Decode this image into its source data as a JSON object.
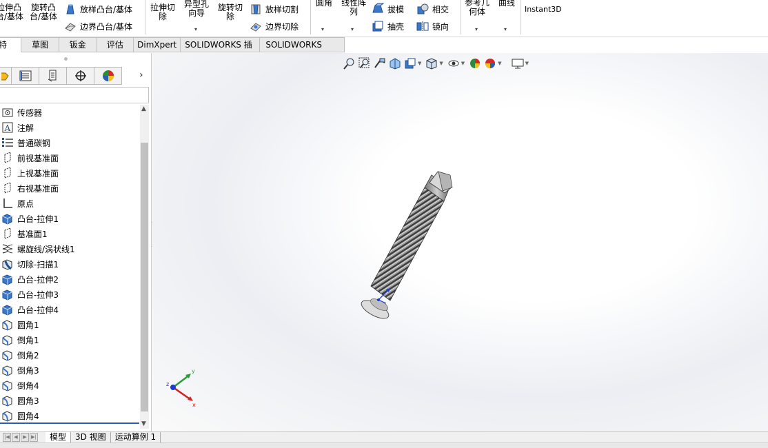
{
  "ribbon": {
    "extrude_boss_label": "拉伸凸\n台/基体",
    "revolve_boss_label": "旋转凸\n台/基体",
    "loft_boss_label": "放样凸台/基体",
    "boundary_boss_label": "边界凸台/基体",
    "extrude_cut_label": "拉伸切\n除",
    "hole_wizard_label": "异型孔\n向导",
    "revolve_cut_label": "旋转切\n除",
    "loft_cut_label": "放样切割",
    "boundary_cut_label": "边界切除",
    "fillet_label": "圆角",
    "linear_pattern_label": "线性阵\n列",
    "draft_label": "拔模",
    "intersect_label": "相交",
    "shell_label": "抽壳",
    "mirror_label": "镜向",
    "ref_geometry_label": "参考几\n何体",
    "curves_label": "曲线",
    "instant3d_label": "Instant3D"
  },
  "tabs": [
    "特征",
    "草图",
    "钣金",
    "评估",
    "DimXpert",
    "SOLIDWORKS 插件",
    "SOLIDWORKS MBD"
  ],
  "feature_tree": [
    {
      "label": "传感器",
      "icon": "sensor-icon"
    },
    {
      "label": "注解",
      "icon": "annotation-icon"
    },
    {
      "label": "普通碳钢",
      "icon": "material-icon"
    },
    {
      "label": "前视基准面",
      "icon": "plane-icon"
    },
    {
      "label": "上视基准面",
      "icon": "plane-icon"
    },
    {
      "label": "右视基准面",
      "icon": "plane-icon"
    },
    {
      "label": "原点",
      "icon": "origin-icon"
    },
    {
      "label": "凸台-拉伸1",
      "icon": "boss-extrude-icon"
    },
    {
      "label": "基准面1",
      "icon": "plane-icon"
    },
    {
      "label": "螺旋线/涡状线1",
      "icon": "helix-icon"
    },
    {
      "label": "切除-扫描1",
      "icon": "cut-sweep-icon"
    },
    {
      "label": "凸台-拉伸2",
      "icon": "boss-extrude-icon"
    },
    {
      "label": "凸台-拉伸3",
      "icon": "boss-extrude-icon"
    },
    {
      "label": "凸台-拉伸4",
      "icon": "boss-extrude-icon"
    },
    {
      "label": "圆角1",
      "icon": "fillet-icon"
    },
    {
      "label": "倒角1",
      "icon": "chamfer-icon"
    },
    {
      "label": "倒角2",
      "icon": "chamfer-icon"
    },
    {
      "label": "倒角3",
      "icon": "chamfer-icon"
    },
    {
      "label": "倒角4",
      "icon": "chamfer-icon"
    },
    {
      "label": "圆角3",
      "icon": "fillet-icon"
    },
    {
      "label": "圆角4",
      "icon": "fillet-icon"
    }
  ],
  "bottom_tabs": [
    "模型",
    "3D 视图",
    "运动算例 1"
  ],
  "triad": {
    "x": "x",
    "y": "y",
    "z": "z"
  },
  "colors": {
    "accent": "#2a5fb0",
    "tab_bg": "#e9e9e9"
  }
}
